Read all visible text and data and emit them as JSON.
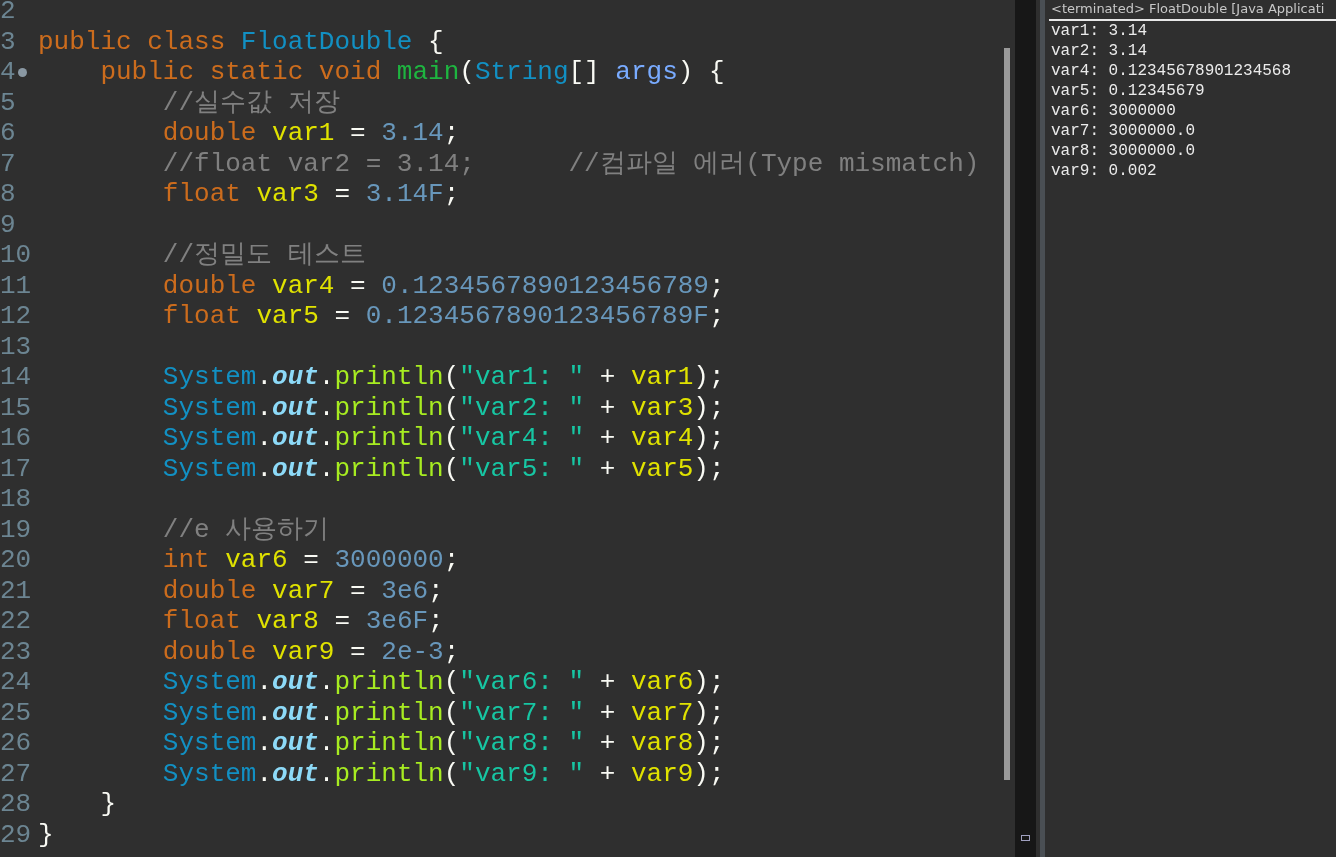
{
  "editor": {
    "lines": [
      {
        "number": "2",
        "fold": false
      },
      {
        "number": "3",
        "fold": false,
        "tokens": [
          {
            "kind": "keyword",
            "text": "public class "
          },
          {
            "kind": "type",
            "text": "FloatDouble"
          },
          {
            "kind": "plain",
            "text": " {"
          }
        ]
      },
      {
        "number": "4",
        "fold": true,
        "tokens": [
          {
            "kind": "keyword",
            "text": "    public static void "
          },
          {
            "kind": "method-decl",
            "text": "main"
          },
          {
            "kind": "plain",
            "text": "("
          },
          {
            "kind": "type",
            "text": "String"
          },
          {
            "kind": "plain",
            "text": "[] "
          },
          {
            "kind": "param",
            "text": "args"
          },
          {
            "kind": "plain",
            "text": ") {"
          }
        ]
      },
      {
        "number": "5",
        "fold": false,
        "tokens": [
          {
            "kind": "comment",
            "text": "        //실수값 저장"
          }
        ]
      },
      {
        "number": "6",
        "fold": false,
        "tokens": [
          {
            "kind": "keyword",
            "text": "        double "
          },
          {
            "kind": "variable",
            "text": "var1"
          },
          {
            "kind": "plain",
            "text": " = "
          },
          {
            "kind": "number",
            "text": "3.14"
          },
          {
            "kind": "plain",
            "text": ";"
          }
        ]
      },
      {
        "number": "7",
        "fold": false,
        "tokens": [
          {
            "kind": "comment",
            "text": "        //float var2 = 3.14;      //컴파일 에러(Type mismatch)"
          }
        ]
      },
      {
        "number": "8",
        "fold": false,
        "tokens": [
          {
            "kind": "keyword",
            "text": "        float "
          },
          {
            "kind": "variable",
            "text": "var3"
          },
          {
            "kind": "plain",
            "text": " = "
          },
          {
            "kind": "number",
            "text": "3.14F"
          },
          {
            "kind": "plain",
            "text": ";"
          }
        ]
      },
      {
        "number": "9",
        "fold": false
      },
      {
        "number": "10",
        "fold": false,
        "tokens": [
          {
            "kind": "comment",
            "text": "        //정밀도 테스트"
          }
        ]
      },
      {
        "number": "11",
        "fold": false,
        "tokens": [
          {
            "kind": "keyword",
            "text": "        double "
          },
          {
            "kind": "variable",
            "text": "var4"
          },
          {
            "kind": "plain",
            "text": " = "
          },
          {
            "kind": "number",
            "text": "0.1234567890123456789"
          },
          {
            "kind": "plain",
            "text": ";"
          }
        ]
      },
      {
        "number": "12",
        "fold": false,
        "tokens": [
          {
            "kind": "keyword",
            "text": "        float "
          },
          {
            "kind": "variable",
            "text": "var5"
          },
          {
            "kind": "plain",
            "text": " = "
          },
          {
            "kind": "number",
            "text": "0.1234567890123456789F"
          },
          {
            "kind": "plain",
            "text": ";"
          }
        ]
      },
      {
        "number": "13",
        "fold": false
      },
      {
        "number": "14",
        "fold": false,
        "tokens": [
          {
            "kind": "type",
            "text": "        System"
          },
          {
            "kind": "plain",
            "text": "."
          },
          {
            "kind": "field",
            "text": "out"
          },
          {
            "kind": "plain",
            "text": "."
          },
          {
            "kind": "method",
            "text": "println"
          },
          {
            "kind": "plain",
            "text": "("
          },
          {
            "kind": "string",
            "text": "\"var1: \""
          },
          {
            "kind": "plain",
            "text": " + "
          },
          {
            "kind": "variable",
            "text": "var1"
          },
          {
            "kind": "plain",
            "text": ");"
          }
        ]
      },
      {
        "number": "15",
        "fold": false,
        "tokens": [
          {
            "kind": "type",
            "text": "        System"
          },
          {
            "kind": "plain",
            "text": "."
          },
          {
            "kind": "field",
            "text": "out"
          },
          {
            "kind": "plain",
            "text": "."
          },
          {
            "kind": "method",
            "text": "println"
          },
          {
            "kind": "plain",
            "text": "("
          },
          {
            "kind": "string",
            "text": "\"var2: \""
          },
          {
            "kind": "plain",
            "text": " + "
          },
          {
            "kind": "variable",
            "text": "var3"
          },
          {
            "kind": "plain",
            "text": ");"
          }
        ]
      },
      {
        "number": "16",
        "fold": false,
        "tokens": [
          {
            "kind": "type",
            "text": "        System"
          },
          {
            "kind": "plain",
            "text": "."
          },
          {
            "kind": "field",
            "text": "out"
          },
          {
            "kind": "plain",
            "text": "."
          },
          {
            "kind": "method",
            "text": "println"
          },
          {
            "kind": "plain",
            "text": "("
          },
          {
            "kind": "string",
            "text": "\"var4: \""
          },
          {
            "kind": "plain",
            "text": " + "
          },
          {
            "kind": "variable",
            "text": "var4"
          },
          {
            "kind": "plain",
            "text": ");"
          }
        ]
      },
      {
        "number": "17",
        "fold": false,
        "tokens": [
          {
            "kind": "type",
            "text": "        System"
          },
          {
            "kind": "plain",
            "text": "."
          },
          {
            "kind": "field",
            "text": "out"
          },
          {
            "kind": "plain",
            "text": "."
          },
          {
            "kind": "method",
            "text": "println"
          },
          {
            "kind": "plain",
            "text": "("
          },
          {
            "kind": "string",
            "text": "\"var5: \""
          },
          {
            "kind": "plain",
            "text": " + "
          },
          {
            "kind": "variable",
            "text": "var5"
          },
          {
            "kind": "plain",
            "text": ");"
          }
        ]
      },
      {
        "number": "18",
        "fold": false
      },
      {
        "number": "19",
        "fold": false,
        "tokens": [
          {
            "kind": "comment",
            "text": "        //e 사용하기"
          }
        ]
      },
      {
        "number": "20",
        "fold": false,
        "tokens": [
          {
            "kind": "keyword",
            "text": "        int "
          },
          {
            "kind": "variable",
            "text": "var6"
          },
          {
            "kind": "plain",
            "text": " = "
          },
          {
            "kind": "number",
            "text": "3000000"
          },
          {
            "kind": "plain",
            "text": ";"
          }
        ]
      },
      {
        "number": "21",
        "fold": false,
        "tokens": [
          {
            "kind": "keyword",
            "text": "        double "
          },
          {
            "kind": "variable",
            "text": "var7"
          },
          {
            "kind": "plain",
            "text": " = "
          },
          {
            "kind": "number",
            "text": "3e6"
          },
          {
            "kind": "plain",
            "text": ";"
          }
        ]
      },
      {
        "number": "22",
        "fold": false,
        "tokens": [
          {
            "kind": "keyword",
            "text": "        float "
          },
          {
            "kind": "variable",
            "text": "var8"
          },
          {
            "kind": "plain",
            "text": " = "
          },
          {
            "kind": "number",
            "text": "3e6F"
          },
          {
            "kind": "plain",
            "text": ";"
          }
        ]
      },
      {
        "number": "23",
        "fold": false,
        "tokens": [
          {
            "kind": "keyword",
            "text": "        double "
          },
          {
            "kind": "variable",
            "text": "var9"
          },
          {
            "kind": "plain",
            "text": " = "
          },
          {
            "kind": "number",
            "text": "2e-3"
          },
          {
            "kind": "plain",
            "text": ";"
          }
        ]
      },
      {
        "number": "24",
        "fold": false,
        "tokens": [
          {
            "kind": "type",
            "text": "        System"
          },
          {
            "kind": "plain",
            "text": "."
          },
          {
            "kind": "field",
            "text": "out"
          },
          {
            "kind": "plain",
            "text": "."
          },
          {
            "kind": "method",
            "text": "println"
          },
          {
            "kind": "plain",
            "text": "("
          },
          {
            "kind": "string",
            "text": "\"var6: \""
          },
          {
            "kind": "plain",
            "text": " + "
          },
          {
            "kind": "variable",
            "text": "var6"
          },
          {
            "kind": "plain",
            "text": ");"
          }
        ]
      },
      {
        "number": "25",
        "fold": false,
        "tokens": [
          {
            "kind": "type",
            "text": "        System"
          },
          {
            "kind": "plain",
            "text": "."
          },
          {
            "kind": "field",
            "text": "out"
          },
          {
            "kind": "plain",
            "text": "."
          },
          {
            "kind": "method",
            "text": "println"
          },
          {
            "kind": "plain",
            "text": "("
          },
          {
            "kind": "string",
            "text": "\"var7: \""
          },
          {
            "kind": "plain",
            "text": " + "
          },
          {
            "kind": "variable",
            "text": "var7"
          },
          {
            "kind": "plain",
            "text": ");"
          }
        ]
      },
      {
        "number": "26",
        "fold": false,
        "tokens": [
          {
            "kind": "type",
            "text": "        System"
          },
          {
            "kind": "plain",
            "text": "."
          },
          {
            "kind": "field",
            "text": "out"
          },
          {
            "kind": "plain",
            "text": "."
          },
          {
            "kind": "method",
            "text": "println"
          },
          {
            "kind": "plain",
            "text": "("
          },
          {
            "kind": "string",
            "text": "\"var8: \""
          },
          {
            "kind": "plain",
            "text": " + "
          },
          {
            "kind": "variable",
            "text": "var8"
          },
          {
            "kind": "plain",
            "text": ");"
          }
        ]
      },
      {
        "number": "27",
        "fold": false,
        "tokens": [
          {
            "kind": "type",
            "text": "        System"
          },
          {
            "kind": "plain",
            "text": "."
          },
          {
            "kind": "field",
            "text": "out"
          },
          {
            "kind": "plain",
            "text": "."
          },
          {
            "kind": "method",
            "text": "println"
          },
          {
            "kind": "plain",
            "text": "("
          },
          {
            "kind": "string",
            "text": "\"var9: \""
          },
          {
            "kind": "plain",
            "text": " + "
          },
          {
            "kind": "variable",
            "text": "var9"
          },
          {
            "kind": "plain",
            "text": ");"
          }
        ]
      },
      {
        "number": "28",
        "fold": false,
        "tokens": [
          {
            "kind": "plain",
            "text": "    }"
          }
        ]
      },
      {
        "number": "29",
        "fold": false,
        "tokens": [
          {
            "kind": "plain",
            "text": "}"
          }
        ]
      }
    ]
  },
  "console": {
    "header": "<terminated> FloatDouble [Java Applicati",
    "output": [
      "var1: 3.14",
      "var2: 3.14",
      "var4: 0.12345678901234568",
      "var5: 0.12345679",
      "var6: 3000000",
      "var7: 3000000.0",
      "var8: 3000000.0",
      "var9: 0.002"
    ]
  }
}
